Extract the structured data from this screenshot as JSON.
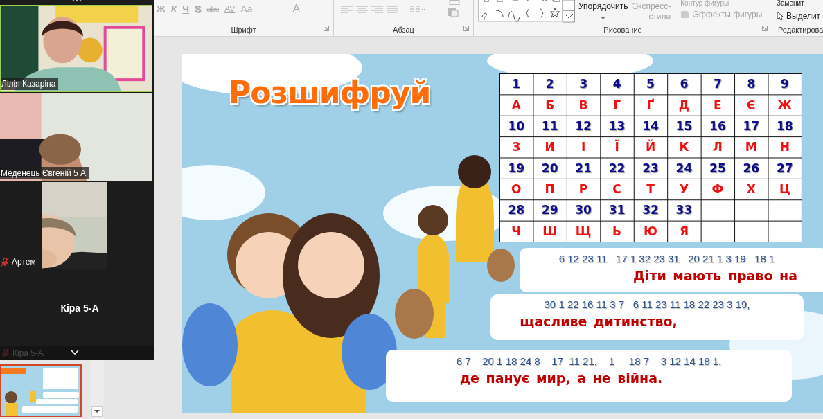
{
  "ribbon": {
    "font": {
      "label": "Шрифт",
      "buttons": [
        {
          "text": "Ж",
          "kind": "bold",
          "disabled": true
        },
        {
          "text": "К",
          "kind": "italic",
          "disabled": true
        },
        {
          "text": "Ч",
          "kind": "underline",
          "disabled": true
        },
        {
          "text": "S",
          "kind": "shadow",
          "disabled": true
        },
        {
          "text": "abc",
          "kind": "strike",
          "disabled": true
        },
        {
          "text": "AV",
          "kind": "spacing",
          "disabled": true
        },
        {
          "text": "Aa",
          "kind": "case",
          "disabled": true
        },
        {
          "text": "A",
          "kind": "color",
          "disabled": true
        }
      ]
    },
    "paragraph": {
      "label": "Абзац"
    },
    "drawing": {
      "label": "Рисование",
      "arrange": {
        "text": "Упорядочить",
        "disabled": false
      },
      "quick_styles": {
        "lines": [
          "Экспресс-",
          "стили"
        ],
        "disabled": true
      },
      "outline": {
        "text": "Контур фигуры",
        "disabled": true
      },
      "effects": {
        "text": "Эффекты фигуры",
        "disabled": true
      }
    },
    "editing": {
      "label": "Редактирова",
      "replace": "Заменит",
      "select": "Выделит"
    }
  },
  "thumbnails": [
    {
      "selected": true
    }
  ],
  "meeting": {
    "participants": [
      {
        "name": "Лілія Казаріна",
        "kind": "landscape",
        "video": true,
        "active_speaker": true,
        "muted": false
      },
      {
        "name": "Меденець Євгеній 5 А",
        "kind": "landscape",
        "video": true,
        "active_speaker": false,
        "muted": false
      },
      {
        "name": "Артем",
        "kind": "portrait",
        "video": true,
        "active_speaker": false,
        "muted": true
      },
      {
        "name": "Кіра 5-А",
        "video": false,
        "active_speaker": false
      }
    ],
    "footer_name": "Кіра 5-А",
    "footer_muted": true
  },
  "slide": {
    "title": "Розшифруй",
    "table": {
      "rows": [
        {
          "kind": "number",
          "cells": [
            "1",
            "2",
            "3",
            "4",
            "5",
            "6",
            "7",
            "8",
            "9"
          ]
        },
        {
          "kind": "letter",
          "cells": [
            "А",
            "Б",
            "В",
            "Г",
            "Ґ",
            "Д",
            "Е",
            "Є",
            "Ж"
          ]
        },
        {
          "kind": "number",
          "cells": [
            "10",
            "11",
            "12",
            "13",
            "14",
            "15",
            "16",
            "17",
            "18"
          ]
        },
        {
          "kind": "letter",
          "cells": [
            "З",
            "И",
            "І",
            "Ї",
            "Й",
            "К",
            "Л",
            "М",
            "Н"
          ]
        },
        {
          "kind": "number",
          "cells": [
            "19",
            "20",
            "21",
            "22",
            "23",
            "24",
            "25",
            "26",
            "27"
          ]
        },
        {
          "kind": "letter",
          "cells": [
            "О",
            "П",
            "Р",
            "С",
            "Т",
            "У",
            "Ф",
            "Х",
            "Ц"
          ]
        },
        {
          "kind": "number",
          "cells": [
            "28",
            "29",
            "30",
            "31",
            "32",
            "33",
            "",
            "",
            ""
          ]
        },
        {
          "kind": "letter",
          "cells": [
            "Ч",
            "Ш",
            "Щ",
            "Ь",
            "Ю",
            "Я",
            "",
            "",
            ""
          ]
        }
      ]
    },
    "lines": [
      {
        "code": "6 12 23 11   17 1 32 23 31   20 21 1 3 19   18 1",
        "answer": "Діти мають право на"
      },
      {
        "code": "30 1 22 16 11 3 7   6 11 23 11 18 22 23 3 19,",
        "answer": "щасливе дитинство,"
      },
      {
        "code": "6 7    20 1 18 24 8    17  11 21,    1     18 7    3 12 14 18 1.",
        "answer": "де панує мир, а не війна."
      }
    ]
  }
}
